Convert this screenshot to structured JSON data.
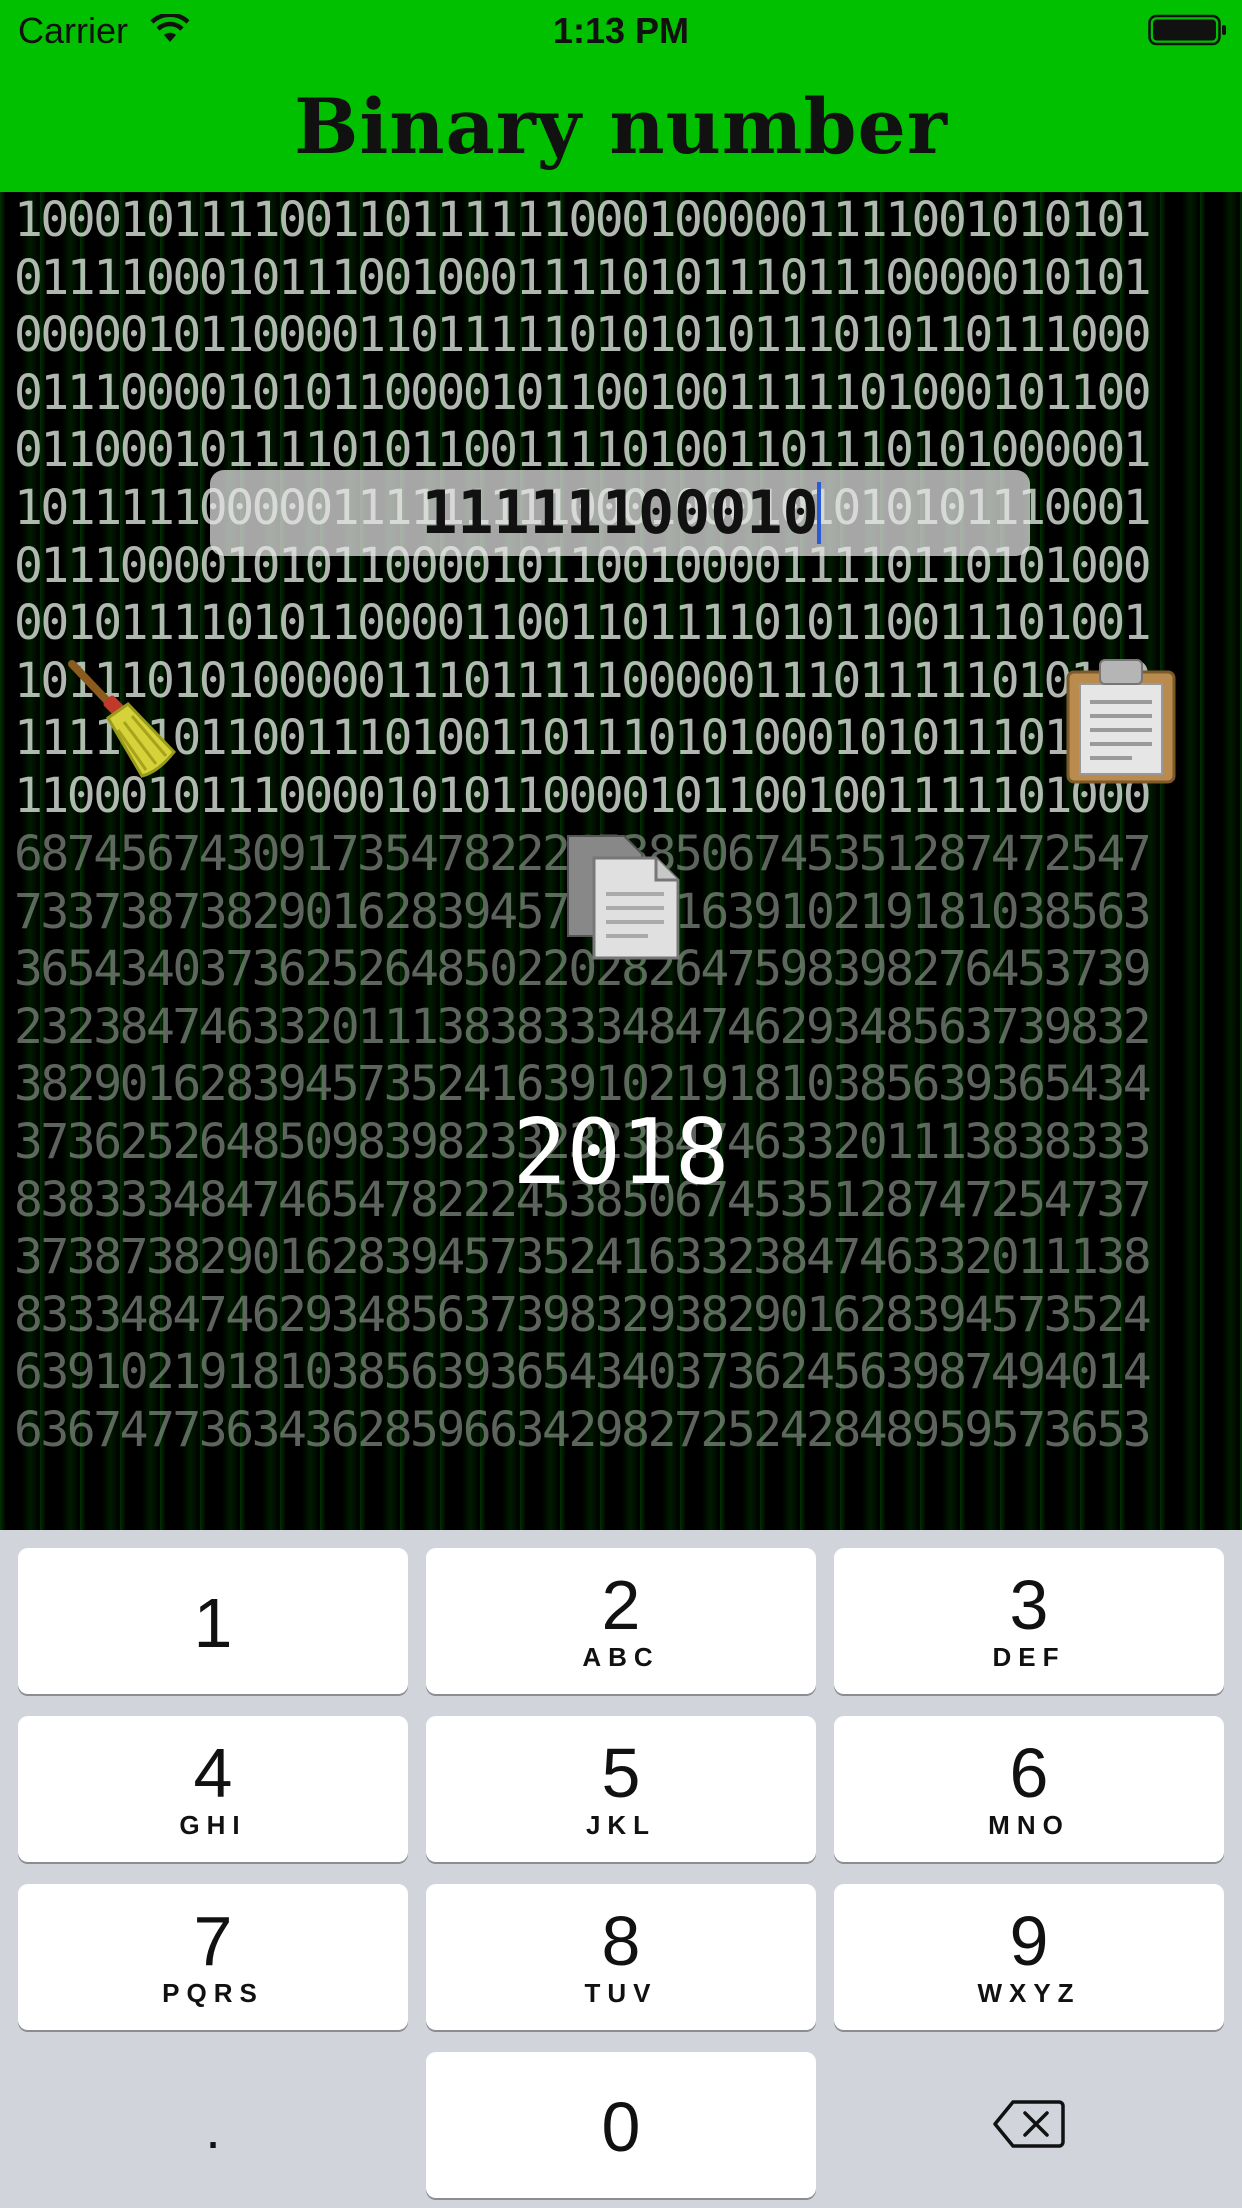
{
  "status_bar": {
    "carrier": "Carrier",
    "time": "1:13 PM"
  },
  "header": {
    "title": "Binary number"
  },
  "matrix": {
    "binary_rows": [
      "1000101111001101111110001000001111001010101",
      "0111100010111001000111101011101110000010101",
      "0000010110000110111110101010111010110111000",
      "0111000010101100001011001001111101000101100",
      "0110001011110101100111101001101110101000001",
      "1011111000001111111110001000101010101110001",
      "0111000010101100001011001000011110110101000",
      "0010111101011000011001101111010110011101001",
      "1011101010000011101111100000111011111010110",
      "1111010110011101001101110101000101011101011",
      "1100010111000010101100001011001001111101000"
    ],
    "decimal_rows": [
      "6874567430917354782224538506745351287472547",
      "7337387382901628394573524163910219181038563",
      "3654340373625264850220282647598398276453739",
      "2323847463320111383833348474629348563739832",
      "3829016283945735241639102191810385639365434",
      "3736252648509839823323238474633201113838333",
      "8383334847465478222453850674535128747254737",
      "3738738290162839457352416332384746332011138",
      "8333484746293485637398329382901628394573524",
      "6391021918103856393654340373624563987494014",
      "6367477363436285966342982725242848959573653"
    ]
  },
  "input": {
    "value": "11111100010",
    "placeholder": ""
  },
  "actions": {
    "clear_icon": "broom-icon",
    "paste_icon": "clipboard-icon",
    "copy_icon": "copy-documents-icon"
  },
  "result": {
    "decimal": "2018"
  },
  "keypad": {
    "keys": [
      {
        "num": "1",
        "letters": ""
      },
      {
        "num": "2",
        "letters": "ABC"
      },
      {
        "num": "3",
        "letters": "DEF"
      },
      {
        "num": "4",
        "letters": "GHI"
      },
      {
        "num": "5",
        "letters": "JKL"
      },
      {
        "num": "6",
        "letters": "MNO"
      },
      {
        "num": "7",
        "letters": "PQRS"
      },
      {
        "num": "8",
        "letters": "TUV"
      },
      {
        "num": "9",
        "letters": "WXYZ"
      },
      {
        "num": ".",
        "letters": ""
      },
      {
        "num": "0",
        "letters": ""
      }
    ],
    "delete_icon": "backspace-icon"
  },
  "colors": {
    "header_bg": "#00c000",
    "keypad_bg": "#d1d4db",
    "caret": "#2a5bd7"
  }
}
